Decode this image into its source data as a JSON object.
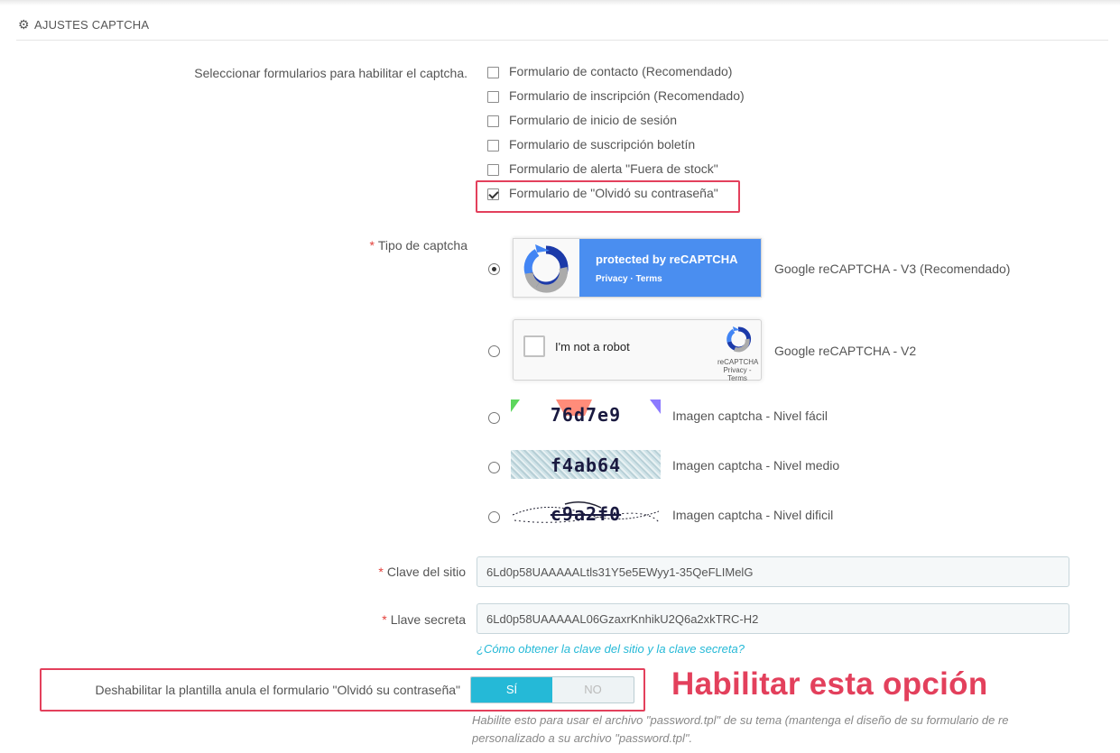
{
  "header": {
    "title": "AJUSTES CAPTCHA",
    "icon": "gear-icon"
  },
  "forms": {
    "label": "Seleccionar formularios para habilitar el captcha.",
    "items": [
      {
        "label": "Formulario de contacto (Recomendado)",
        "checked": false
      },
      {
        "label": "Formulario de inscripción (Recomendado)",
        "checked": false
      },
      {
        "label": "Formulario de inicio de sesión",
        "checked": false
      },
      {
        "label": "Formulario de suscripción boletín",
        "checked": false
      },
      {
        "label": "Formulario de alerta \"Fuera de stock\"",
        "checked": false
      },
      {
        "label": "Formulario de \"Olvidó su contraseña\"",
        "checked": true
      }
    ]
  },
  "captcha_type": {
    "required_mark": "*",
    "label": "Tipo de captcha",
    "selected": "v3",
    "options": [
      {
        "label": "Google reCAPTCHA - V3 (Recomendado)"
      },
      {
        "label": "Google reCAPTCHA - V2"
      },
      {
        "label": "Imagen captcha - Nivel fácil",
        "code": "76d7e9"
      },
      {
        "label": "Imagen captcha - Nivel medio",
        "code": "f4ab64"
      },
      {
        "label": "Imagen captcha - Nivel dificil",
        "code": "c9a2f0"
      }
    ],
    "v3_badge": {
      "title": "protected by ",
      "brand": "reCAPTCHA",
      "links": "Privacy · Terms"
    },
    "v2_widget": {
      "text": "I'm not a robot",
      "brand": "reCAPTCHA",
      "links": "Privacy - Terms"
    }
  },
  "site_key": {
    "required_mark": "*",
    "label": "Clave del sitio",
    "value": "6Ld0p58UAAAAALtls31Y5e5EWyy1-35QeFLIMelG"
  },
  "secret_key": {
    "required_mark": "*",
    "label": "Llave secreta",
    "value": "6Ld0p58UAAAAAL06GzaxrKnhikU2Q6a2xkTRC-H2"
  },
  "help_link": "¿Cómo obtener la clave del sitio y la clave secreta?",
  "override": {
    "label": "Deshabilitar la plantilla anula el formulario \"Olvidó su contraseña\"",
    "yes": "SÍ",
    "no": "NO",
    "value": "yes",
    "help_line1": "Habilite esto para usar el archivo \"password.tpl\" de su tema (mantenga el diseño de su formulario de re",
    "help_line2": "personalizado a su archivo \"password.tpl\"."
  },
  "annotation": "Habilitar esta opción",
  "colors": {
    "accent": "#25b9d7",
    "highlight": "#e3405c",
    "required": "#e3403b",
    "recaptcha_blue": "#4a8ef0"
  }
}
